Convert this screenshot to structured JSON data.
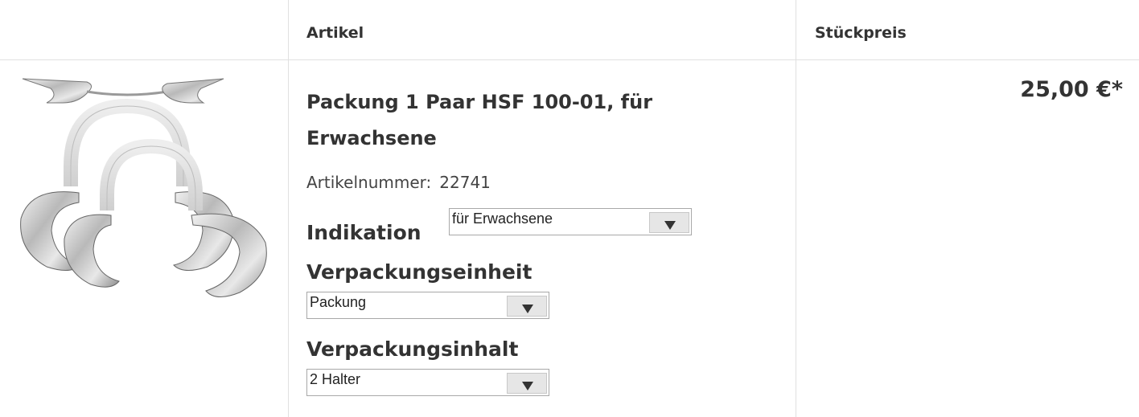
{
  "header": {
    "col_article": "Artikel",
    "col_price": "Stückpreis"
  },
  "product": {
    "image_icon": "cheek-retractor-image",
    "title": "Packung 1 Paar HSF 100-01, für Erwachsene",
    "article_number_label": "Artikelnummer:",
    "article_number_value": "22741",
    "price": "25,00 €*",
    "options": [
      {
        "label": "Indikation",
        "value": "für Erwachsene"
      },
      {
        "label": "Verpackungseinheit",
        "value": "Packung"
      },
      {
        "label": "Verpackungsinhalt",
        "value": "2 Halter"
      }
    ]
  }
}
